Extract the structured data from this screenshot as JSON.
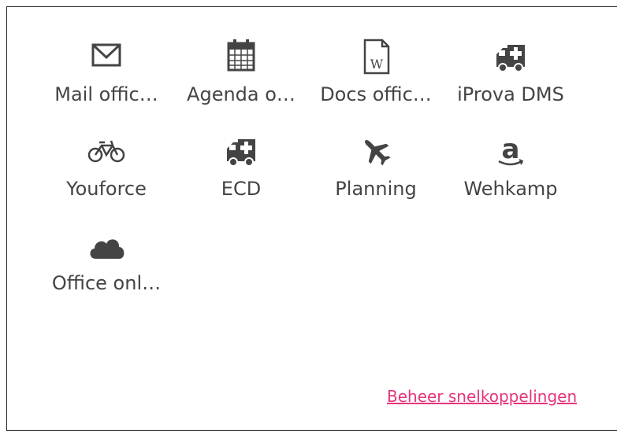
{
  "shortcuts": [
    {
      "label": "Mail offic…",
      "icon": "mail-icon"
    },
    {
      "label": "Agenda o…",
      "icon": "calendar-icon"
    },
    {
      "label": "Docs offic…",
      "icon": "word-document-icon"
    },
    {
      "label": "iProva DMS",
      "icon": "ambulance-icon"
    },
    {
      "label": "Youforce",
      "icon": "bicycle-icon"
    },
    {
      "label": "ECD",
      "icon": "ambulance-icon"
    },
    {
      "label": "Planning",
      "icon": "airplane-icon"
    },
    {
      "label": "Wehkamp",
      "icon": "amazon-icon"
    },
    {
      "label": "Office onl…",
      "icon": "cloud-icon"
    }
  ],
  "footer": {
    "manage_link": "Beheer snelkoppelingen"
  },
  "colors": {
    "icon": "#444444",
    "link": "#e6347c"
  }
}
